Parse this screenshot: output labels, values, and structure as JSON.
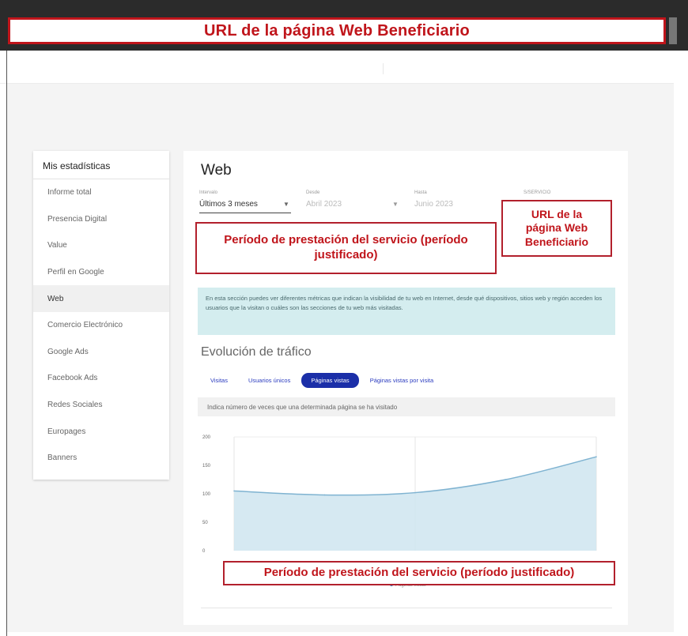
{
  "header": {
    "banner": "URL de la página Web Beneficiario"
  },
  "sidebar": {
    "title": "Mis estadísticas",
    "items": [
      {
        "label": "Informe total"
      },
      {
        "label": "Presencia Digital"
      },
      {
        "label": "Value"
      },
      {
        "label": "Perfil en Google"
      },
      {
        "label": "Web",
        "active": true
      },
      {
        "label": "Comercio Electrónico"
      },
      {
        "label": "Google Ads"
      },
      {
        "label": "Facebook Ads"
      },
      {
        "label": "Redes Sociales"
      },
      {
        "label": "Europages"
      },
      {
        "label": "Banners"
      }
    ]
  },
  "main": {
    "title": "Web",
    "filters": {
      "interval": {
        "label": "Intervalo",
        "value": "Últimos 3 meses"
      },
      "from": {
        "label": "Desde",
        "value": "Abril 2023"
      },
      "to": {
        "label": "Hasta",
        "value": "Junio 2023"
      },
      "service": {
        "label": "S/SERVICIO"
      }
    },
    "info": "En esta sección puedes ver diferentes métricas que indican la visibilidad de tu web en Internet, desde qué dispositivos, sitios web y región acceden los usuarios que la visitan o cuáles son las secciones de tu web más visitadas.",
    "section_title": "Evolución de tráfico",
    "tabs": [
      {
        "label": "Visitas"
      },
      {
        "label": "Usuarios únicos"
      },
      {
        "label": "Páginas vistas",
        "active": true
      },
      {
        "label": "Páginas vistas por visita"
      }
    ],
    "hint": "Indica número de veces que una determinada página se ha visitado"
  },
  "annotations": {
    "period_top": "Período de prestación del servicio (período justificado)",
    "url_right": "URL de la página Web Beneficiario",
    "period_bottom": "Período de prestación del servicio (período justificado)"
  },
  "colors": {
    "annotation_red": "#c0151b",
    "active_tab": "#1b2fa8",
    "info_bg": "#d4edef",
    "area_fill": "#cfe5f0",
    "line": "#7fb3d1"
  },
  "chart_data": {
    "type": "area",
    "yticks": [
      "200",
      "150",
      "100",
      "50",
      "0"
    ],
    "ylim": [
      0,
      200
    ],
    "x": [
      0,
      1,
      2,
      3,
      4
    ],
    "series": [
      {
        "name": "Páginas vistas",
        "values": [
          105,
          98,
          102,
          125,
          165
        ]
      }
    ],
    "legend": "bottom-center",
    "grid": true
  }
}
